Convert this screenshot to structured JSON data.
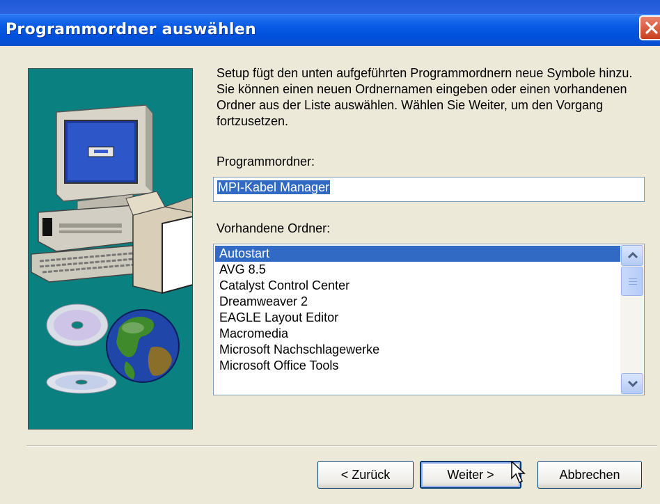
{
  "window": {
    "title": "Programmordner auswählen"
  },
  "content": {
    "description": "Setup fügt den unten aufgeführten Programmordnern neue Symbole hinzu. Sie können einen neuen Ordnernamen eingeben oder einen vorhandenen Ordner aus der Liste auswählen. Wählen Sie Weiter, um den Vorgang fortzusetzen.",
    "folder_label": "Programmordner:",
    "folder_value": "MPI-Kabel Manager",
    "existing_label": "Vorhandene Ordner:",
    "folders": [
      "Autostart",
      "AVG 8.5",
      "Catalyst Control Center",
      "Dreamweaver 2",
      "EAGLE Layout Editor",
      "Macromedia",
      "Microsoft Nachschlagewerke",
      "Microsoft Office Tools"
    ],
    "selected_folder": "Autostart"
  },
  "buttons": {
    "back": "< Zurück",
    "next": "Weiter >",
    "cancel": "Abbrechen"
  },
  "icons": [
    "close-icon",
    "computer-icon",
    "cd-icon",
    "globe-icon",
    "scroll-up-icon",
    "scroll-down-icon",
    "mouse-cursor-icon"
  ],
  "colors": {
    "titlebar": "#0054e3",
    "selection": "#316ac5",
    "side_panel": "#0b8080",
    "dialog_bg": "#ece9d8"
  }
}
